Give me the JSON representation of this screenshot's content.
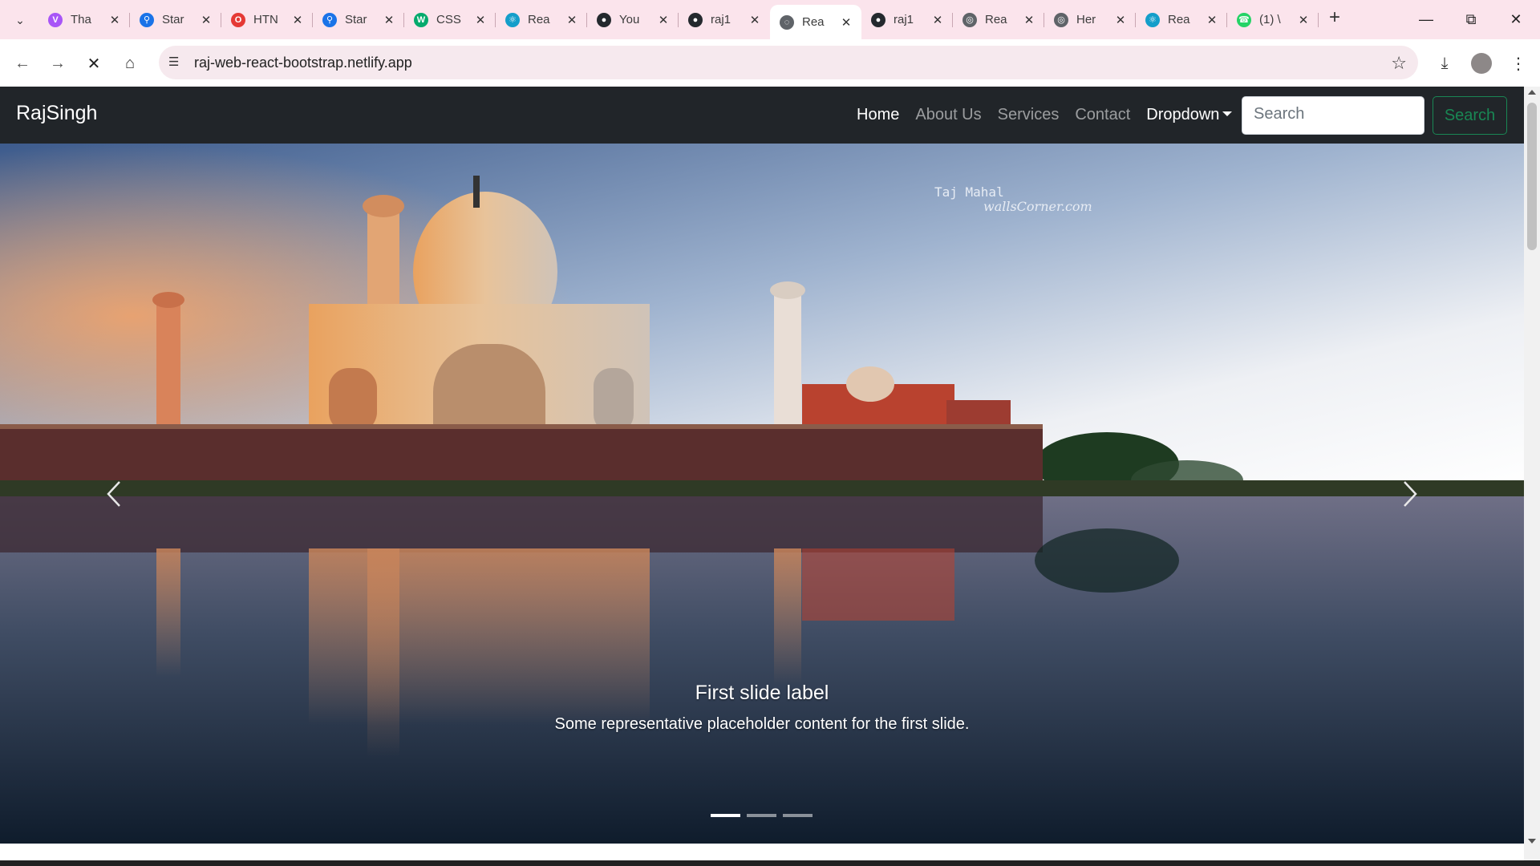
{
  "browser": {
    "tabs": [
      {
        "title": "Tha",
        "icon": "vite-icon",
        "color": "#a855f7",
        "glyph": "V"
      },
      {
        "title": "Star",
        "icon": "search-icon",
        "color": "#1a73e8",
        "glyph": "⚲"
      },
      {
        "title": "HTN",
        "icon": "opera-icon",
        "color": "#e53935",
        "glyph": "O"
      },
      {
        "title": "Star",
        "icon": "search-icon",
        "color": "#1a73e8",
        "glyph": "⚲"
      },
      {
        "title": "CSS",
        "icon": "w3schools-icon",
        "color": "#04aa6d",
        "glyph": "W"
      },
      {
        "title": "Rea",
        "icon": "react-icon",
        "color": "#149eca",
        "glyph": "⚛"
      },
      {
        "title": "You",
        "icon": "github-icon",
        "color": "#24292e",
        "glyph": "●"
      },
      {
        "title": "raj1",
        "icon": "github-icon",
        "color": "#24292e",
        "glyph": "●"
      },
      {
        "title": "Rea",
        "icon": "netlify-loading-icon",
        "color": "#5f6368",
        "glyph": "◌"
      },
      {
        "title": "raj1",
        "icon": "github-icon",
        "color": "#24292e",
        "glyph": "●"
      },
      {
        "title": "Rea",
        "icon": "globe-icon",
        "color": "#5f6368",
        "glyph": "◎"
      },
      {
        "title": "Her",
        "icon": "globe-icon",
        "color": "#5f6368",
        "glyph": "◎"
      },
      {
        "title": "Rea",
        "icon": "react-icon",
        "color": "#149eca",
        "glyph": "⚛"
      },
      {
        "title": "(1) \\",
        "icon": "whatsapp-icon",
        "color": "#25d366",
        "glyph": "☎"
      }
    ],
    "active_tab_index": 8,
    "url": "raj-web-react-bootstrap.netlify.app"
  },
  "navbar": {
    "brand": "RajSingh",
    "links": {
      "home": "Home",
      "about": "About Us",
      "services": "Services",
      "contact": "Contact",
      "dropdown": "Dropdown"
    },
    "search_placeholder": "Search",
    "search_button": "Search"
  },
  "carousel": {
    "watermark_title": "Taj Mahal",
    "watermark_site": "wallsCorner.com",
    "caption_title": "First slide label",
    "caption_text": "Some representative placeholder content for the first slide.",
    "slide_count": 3,
    "active_slide": 0
  },
  "colors": {
    "navbar_bg": "#212529",
    "search_btn": "#198754",
    "tab_strip": "#fbe4ec"
  }
}
